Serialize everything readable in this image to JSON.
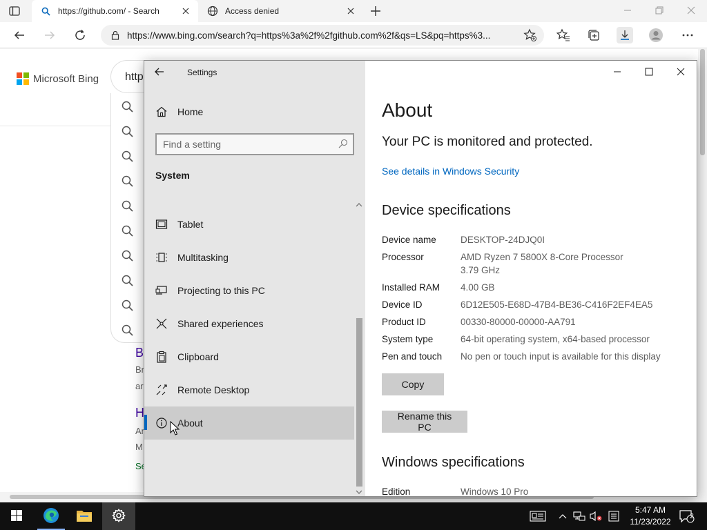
{
  "browser": {
    "tabs": [
      {
        "title": "https://github.com/ - Search",
        "active": true
      },
      {
        "title": "Access denied",
        "active": false
      }
    ],
    "address_url": "https://www.bing.com/search?q=https%3a%2f%2fgithub.com%2f&qs=LS&pq=https%3...",
    "accent": "#0078d4"
  },
  "bing": {
    "logo_text": "Microsoft Bing",
    "query_fragment": "http",
    "results": [
      {
        "title_frag": "B",
        "snippet": [
          "Br",
          "ar"
        ]
      },
      {
        "title_frag": "H",
        "snippet": [
          "Ar",
          "M"
        ],
        "link_frag": "Se"
      }
    ]
  },
  "settings": {
    "app_title": "Settings",
    "home_label": "Home",
    "search_placeholder": "Find a setting",
    "section_label": "System",
    "nav_items": [
      {
        "label": "Tablet",
        "icon": "tablet-icon"
      },
      {
        "label": "Multitasking",
        "icon": "multitasking-icon"
      },
      {
        "label": "Projecting to this PC",
        "icon": "projecting-icon"
      },
      {
        "label": "Shared experiences",
        "icon": "shared-experiences-icon"
      },
      {
        "label": "Clipboard",
        "icon": "clipboard-icon"
      },
      {
        "label": "Remote Desktop",
        "icon": "remote-desktop-icon"
      },
      {
        "label": "About",
        "icon": "info-icon",
        "selected": true
      }
    ],
    "page_title": "About",
    "protection_status": "Your PC is monitored and protected.",
    "security_link": "See details in Windows Security",
    "device_heading": "Device specifications",
    "specs": [
      {
        "key": "Device name",
        "value": "DESKTOP-24DJQ0I"
      },
      {
        "key": "Processor",
        "value": "AMD Ryzen 7 5800X 8-Core Processor",
        "value2": "3.79 GHz"
      },
      {
        "key": "Installed RAM",
        "value": "4.00 GB"
      },
      {
        "key": "Device ID",
        "value": "6D12E505-E68D-47B4-BE36-C416F2EF4EA5"
      },
      {
        "key": "Product ID",
        "value": "00330-80000-00000-AA791"
      },
      {
        "key": "System type",
        "value": "64-bit operating system, x64-based processor"
      },
      {
        "key": "Pen and touch",
        "value": "No pen or touch input is available for this display"
      }
    ],
    "copy_label": "Copy",
    "rename_label": "Rename this PC",
    "windows_heading": "Windows specifications",
    "edition_key": "Edition",
    "edition_value": "Windows 10 Pro"
  },
  "taskbar": {
    "time": "5:47 AM",
    "date": "11/23/2022",
    "notification_count": "2"
  }
}
